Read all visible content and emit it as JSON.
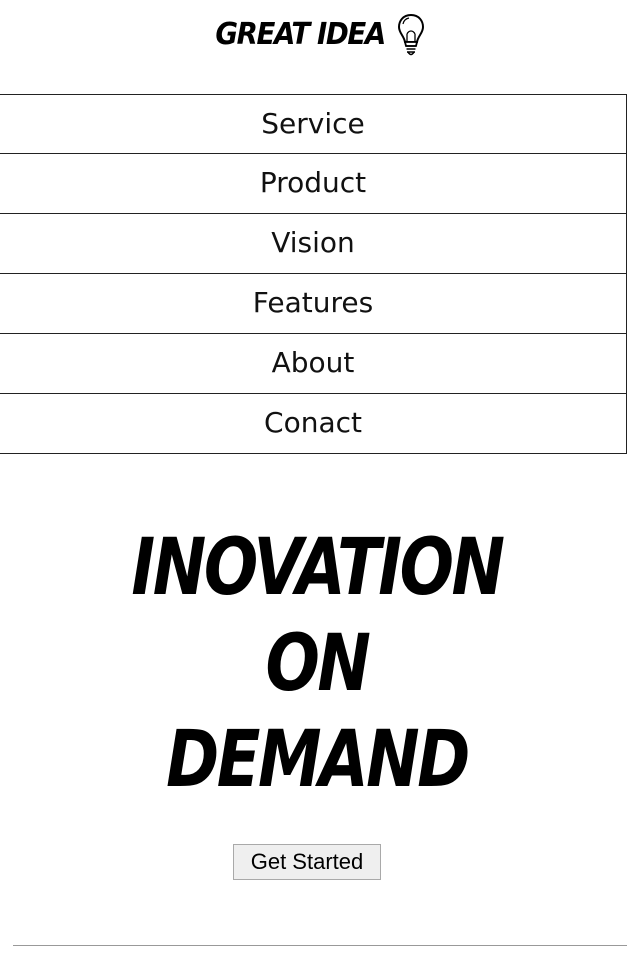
{
  "header": {
    "logo_text": "GREAT IDEA",
    "logo_icon": "lightbulb-icon"
  },
  "nav": {
    "items": [
      {
        "label": "Service"
      },
      {
        "label": "Product"
      },
      {
        "label": "Vision"
      },
      {
        "label": "Features"
      },
      {
        "label": "About"
      },
      {
        "label": "Conact"
      }
    ]
  },
  "hero": {
    "lines": [
      "INOVATION",
      "ON",
      "DEMAND"
    ],
    "cta_label": "Get Started"
  },
  "colors": {
    "text": "#111111",
    "border": "#222222",
    "button_bg": "#efefef",
    "rule": "#999999"
  }
}
